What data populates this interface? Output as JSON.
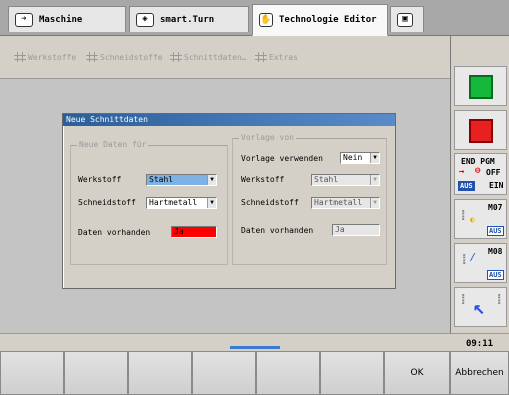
{
  "tabs": [
    {
      "label": "Maschine",
      "icon": "arrow-right-icon",
      "active": false
    },
    {
      "label": "smart.Turn",
      "icon": "diamond-arrow-icon",
      "active": false
    },
    {
      "label": "Technologie Editor",
      "icon": "hand-icon",
      "active": true
    },
    {
      "label": "",
      "icon": "floppy-disk-icon",
      "active": false
    }
  ],
  "menu": [
    {
      "label": "Werkstoffe"
    },
    {
      "label": "Schneidstoffe"
    },
    {
      "label": "Schnittdaten…"
    },
    {
      "label": "Extras"
    }
  ],
  "dialog": {
    "title": "Neue Schnittdaten",
    "left_group": {
      "title": "Neue Daten für",
      "werkstoff_label": "Werkstoff",
      "werkstoff_value": "Stahl",
      "schneidstoff_label": "Schneidstoff",
      "schneidstoff_value": "Hartmetall",
      "daten_label": "Daten vorhanden",
      "daten_value": "Ja"
    },
    "right_group": {
      "title": "Vorlage von",
      "vorlage_label": "Vorlage verwenden",
      "vorlage_value": "Nein",
      "werkstoff_label": "Werkstoff",
      "werkstoff_value": "Stahl",
      "schneidstoff_label": "Schneidstoff",
      "schneidstoff_value": "Hartmetall",
      "daten_label": "Daten vorhanden",
      "daten_value": "Ja"
    }
  },
  "sidebar": {
    "end_pgm": {
      "line1": "END PGM",
      "off": "OFF",
      "aus": "AUS",
      "ein": "EIN"
    },
    "m07": {
      "label": "M07",
      "state": "AUS"
    },
    "m08": {
      "label": "M08",
      "state": "AUS"
    }
  },
  "clock": "09:11",
  "softkeys": [
    {
      "label": ""
    },
    {
      "label": ""
    },
    {
      "label": ""
    },
    {
      "label": ""
    },
    {
      "label": ""
    },
    {
      "label": ""
    },
    {
      "label": "OK"
    },
    {
      "label": "Abbrechen"
    }
  ],
  "colors": {
    "selection": "#7fb2e4",
    "alert": "#ff0000",
    "title_bar": "#2a5f9a",
    "start_green": "#14b83a",
    "stop_red": "#e82020"
  }
}
